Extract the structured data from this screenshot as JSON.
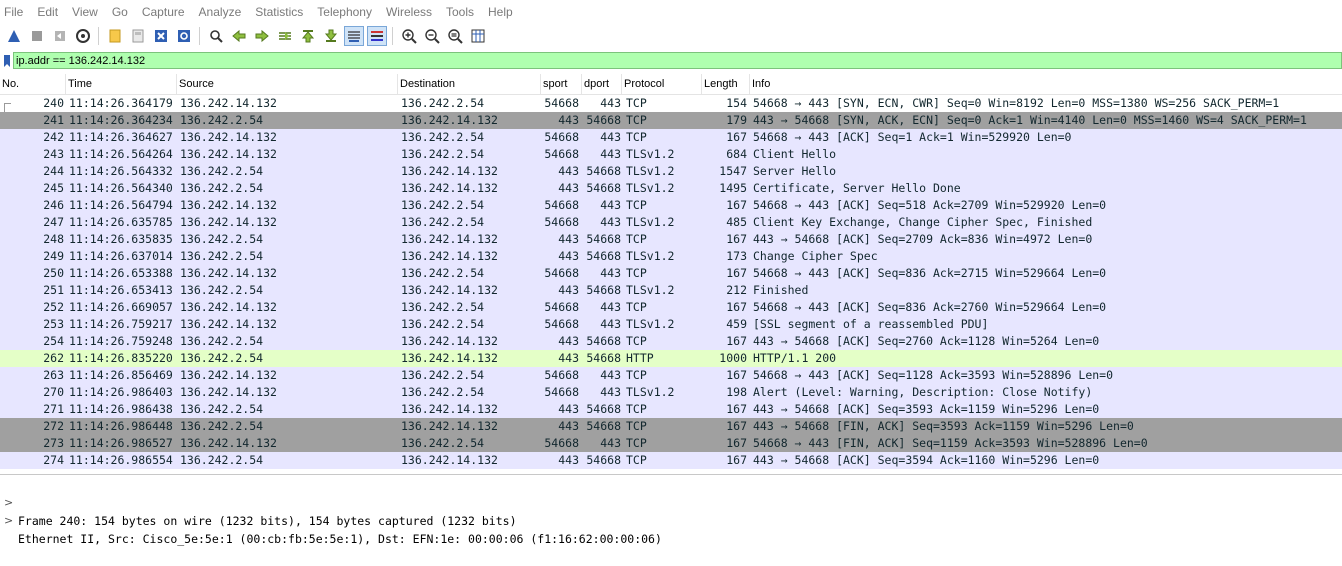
{
  "menu": [
    "File",
    "Edit",
    "View",
    "Go",
    "Capture",
    "Analyze",
    "Statistics",
    "Telephony",
    "Wireless",
    "Tools",
    "Help"
  ],
  "toolbar_icons": [
    "shark-fin-start-icon",
    "stop-icon",
    "restart-icon",
    "options-gear-icon",
    "open-file-icon",
    "save-file-icon",
    "close-file-icon",
    "reload-icon",
    "find-icon",
    "go-back-icon",
    "go-forward-icon",
    "go-to-packet-icon",
    "first-packet-icon",
    "last-packet-icon",
    "autoscroll-icon",
    "colorize-icon",
    "zoom-in-icon",
    "zoom-out-icon",
    "normal-size-icon",
    "resize-columns-icon"
  ],
  "filter": {
    "value": "ip.addr == 136.242.14.132"
  },
  "columns": [
    "No.",
    "Time",
    "Source",
    "Destination",
    "sport",
    "dport",
    "Protocol",
    "Length",
    "Info"
  ],
  "colors": {
    "tcp": "#e7e6ff",
    "http": "#e4ffc7",
    "handshake": "#a0a0a0",
    "filter_bg": "#afffaf"
  },
  "packets": [
    {
      "no": "240",
      "time": "11:14:26.364179",
      "src": "136.242.14.132",
      "dst": "136.242.2.54",
      "sport": "54668",
      "dport": "443",
      "proto": "TCP",
      "len": "154",
      "info": "54668 → 443 [SYN, ECN, CWR] Seq=0 Win=8192 Len=0 MSS=1380 WS=256 SACK_PERM=1",
      "style": "selected"
    },
    {
      "no": "241",
      "time": "11:14:26.364234",
      "src": "136.242.2.54",
      "dst": "136.242.14.132",
      "sport": "443",
      "dport": "54668",
      "proto": "TCP",
      "len": "179",
      "info": "443 → 54668 [SYN, ACK, ECN] Seq=0 Ack=1 Win=4140 Len=0 MSS=1460 WS=4 SACK_PERM=1",
      "style": "handshake"
    },
    {
      "no": "242",
      "time": "11:14:26.364627",
      "src": "136.242.14.132",
      "dst": "136.242.2.54",
      "sport": "54668",
      "dport": "443",
      "proto": "TCP",
      "len": "167",
      "info": "54668 → 443 [ACK] Seq=1 Ack=1 Win=529920 Len=0",
      "style": "tcp"
    },
    {
      "no": "243",
      "time": "11:14:26.564264",
      "src": "136.242.14.132",
      "dst": "136.242.2.54",
      "sport": "54668",
      "dport": "443",
      "proto": "TLSv1.2",
      "len": "684",
      "info": "Client Hello",
      "style": "tls"
    },
    {
      "no": "244",
      "time": "11:14:26.564332",
      "src": "136.242.2.54",
      "dst": "136.242.14.132",
      "sport": "443",
      "dport": "54668",
      "proto": "TLSv1.2",
      "len": "1547",
      "info": "Server Hello",
      "style": "tls"
    },
    {
      "no": "245",
      "time": "11:14:26.564340",
      "src": "136.242.2.54",
      "dst": "136.242.14.132",
      "sport": "443",
      "dport": "54668",
      "proto": "TLSv1.2",
      "len": "1495",
      "info": "Certificate, Server Hello Done",
      "style": "tls"
    },
    {
      "no": "246",
      "time": "11:14:26.564794",
      "src": "136.242.14.132",
      "dst": "136.242.2.54",
      "sport": "54668",
      "dport": "443",
      "proto": "TCP",
      "len": "167",
      "info": "54668 → 443 [ACK] Seq=518 Ack=2709 Win=529920 Len=0",
      "style": "tcp"
    },
    {
      "no": "247",
      "time": "11:14:26.635785",
      "src": "136.242.14.132",
      "dst": "136.242.2.54",
      "sport": "54668",
      "dport": "443",
      "proto": "TLSv1.2",
      "len": "485",
      "info": "Client Key Exchange, Change Cipher Spec, Finished",
      "style": "tls"
    },
    {
      "no": "248",
      "time": "11:14:26.635835",
      "src": "136.242.2.54",
      "dst": "136.242.14.132",
      "sport": "443",
      "dport": "54668",
      "proto": "TCP",
      "len": "167",
      "info": "443 → 54668 [ACK] Seq=2709 Ack=836 Win=4972 Len=0",
      "style": "tcp"
    },
    {
      "no": "249",
      "time": "11:14:26.637014",
      "src": "136.242.2.54",
      "dst": "136.242.14.132",
      "sport": "443",
      "dport": "54668",
      "proto": "TLSv1.2",
      "len": "173",
      "info": "Change Cipher Spec",
      "style": "tls"
    },
    {
      "no": "250",
      "time": "11:14:26.653388",
      "src": "136.242.14.132",
      "dst": "136.242.2.54",
      "sport": "54668",
      "dport": "443",
      "proto": "TCP",
      "len": "167",
      "info": "54668 → 443 [ACK] Seq=836 Ack=2715 Win=529664 Len=0",
      "style": "tcp"
    },
    {
      "no": "251",
      "time": "11:14:26.653413",
      "src": "136.242.2.54",
      "dst": "136.242.14.132",
      "sport": "443",
      "dport": "54668",
      "proto": "TLSv1.2",
      "len": "212",
      "info": "Finished",
      "style": "tls"
    },
    {
      "no": "252",
      "time": "11:14:26.669057",
      "src": "136.242.14.132",
      "dst": "136.242.2.54",
      "sport": "54668",
      "dport": "443",
      "proto": "TCP",
      "len": "167",
      "info": "54668 → 443 [ACK] Seq=836 Ack=2760 Win=529664 Len=0",
      "style": "tcp"
    },
    {
      "no": "253",
      "time": "11:14:26.759217",
      "src": "136.242.14.132",
      "dst": "136.242.2.54",
      "sport": "54668",
      "dport": "443",
      "proto": "TLSv1.2",
      "len": "459",
      "info": "[SSL segment of a reassembled PDU]",
      "style": "tls"
    },
    {
      "no": "254",
      "time": "11:14:26.759248",
      "src": "136.242.2.54",
      "dst": "136.242.14.132",
      "sport": "443",
      "dport": "54668",
      "proto": "TCP",
      "len": "167",
      "info": "443 → 54668 [ACK] Seq=2760 Ack=1128 Win=5264 Len=0",
      "style": "tcp"
    },
    {
      "no": "262",
      "time": "11:14:26.835220",
      "src": "136.242.2.54",
      "dst": "136.242.14.132",
      "sport": "443",
      "dport": "54668",
      "proto": "HTTP",
      "len": "1000",
      "info": "HTTP/1.1 200",
      "style": "http"
    },
    {
      "no": "263",
      "time": "11:14:26.856469",
      "src": "136.242.14.132",
      "dst": "136.242.2.54",
      "sport": "54668",
      "dport": "443",
      "proto": "TCP",
      "len": "167",
      "info": "54668 → 443 [ACK] Seq=1128 Ack=3593 Win=528896 Len=0",
      "style": "tcp"
    },
    {
      "no": "270",
      "time": "11:14:26.986403",
      "src": "136.242.14.132",
      "dst": "136.242.2.54",
      "sport": "54668",
      "dport": "443",
      "proto": "TLSv1.2",
      "len": "198",
      "info": "Alert (Level: Warning, Description: Close Notify)",
      "style": "tls"
    },
    {
      "no": "271",
      "time": "11:14:26.986438",
      "src": "136.242.2.54",
      "dst": "136.242.14.132",
      "sport": "443",
      "dport": "54668",
      "proto": "TCP",
      "len": "167",
      "info": "443 → 54668 [ACK] Seq=3593 Ack=1159 Win=5296 Len=0",
      "style": "tcp"
    },
    {
      "no": "272",
      "time": "11:14:26.986448",
      "src": "136.242.2.54",
      "dst": "136.242.14.132",
      "sport": "443",
      "dport": "54668",
      "proto": "TCP",
      "len": "167",
      "info": "443 → 54668 [FIN, ACK] Seq=3593 Ack=1159 Win=5296 Len=0",
      "style": "handshake"
    },
    {
      "no": "273",
      "time": "11:14:26.986527",
      "src": "136.242.14.132",
      "dst": "136.242.2.54",
      "sport": "54668",
      "dport": "443",
      "proto": "TCP",
      "len": "167",
      "info": "54668 → 443 [FIN, ACK] Seq=1159 Ack=3593 Win=528896 Len=0",
      "style": "handshake"
    },
    {
      "no": "274",
      "time": "11:14:26.986554",
      "src": "136.242.2.54",
      "dst": "136.242.14.132",
      "sport": "443",
      "dport": "54668",
      "proto": "TCP",
      "len": "167",
      "info": "443 → 54668 [ACK] Seq=3594 Ack=1160 Win=5296 Len=0",
      "style": "tcp"
    }
  ],
  "details": [
    "Frame 240: 154 bytes on wire (1232 bits), 154 bytes captured (1232 bits)",
    "Ethernet II, Src: Cisco_5e:5e:1 (00:cb:fb:5e:5e:1), Dst: EFN:1e: 00:00:06 (f1:16:62:00:00:06)"
  ]
}
